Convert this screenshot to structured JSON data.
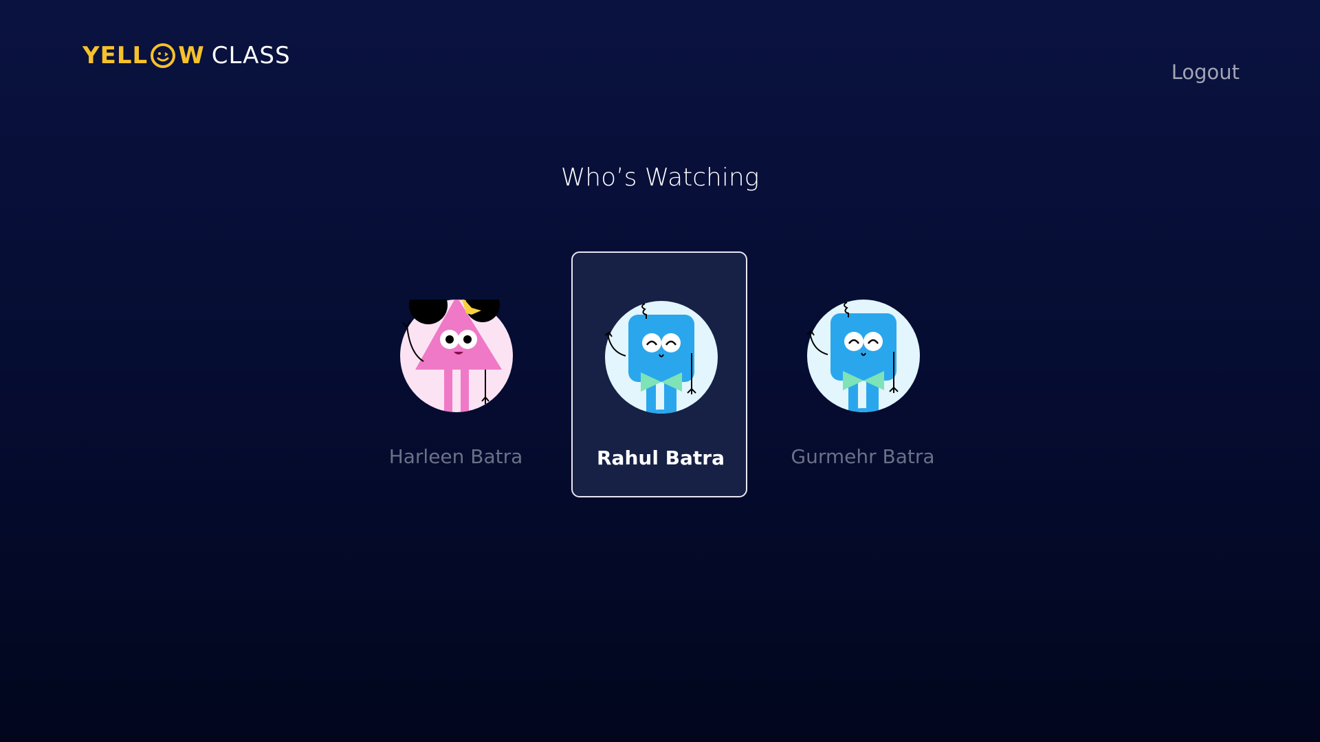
{
  "brand": {
    "logo_part1": "YELL",
    "logo_part2": "W",
    "logo_part3": "CLASS",
    "accent_color": "#f6c12a"
  },
  "header": {
    "logout_label": "Logout"
  },
  "main": {
    "title": "Who’s Watching",
    "profiles": [
      {
        "name": "Harleen Batra",
        "avatar": "pink-triangle-character-icon",
        "selected": false
      },
      {
        "name": "Rahul Batra",
        "avatar": "blue-square-character-icon",
        "selected": true
      },
      {
        "name": "Gurmehr Batra",
        "avatar": "blue-square-character-icon",
        "selected": false
      }
    ]
  }
}
